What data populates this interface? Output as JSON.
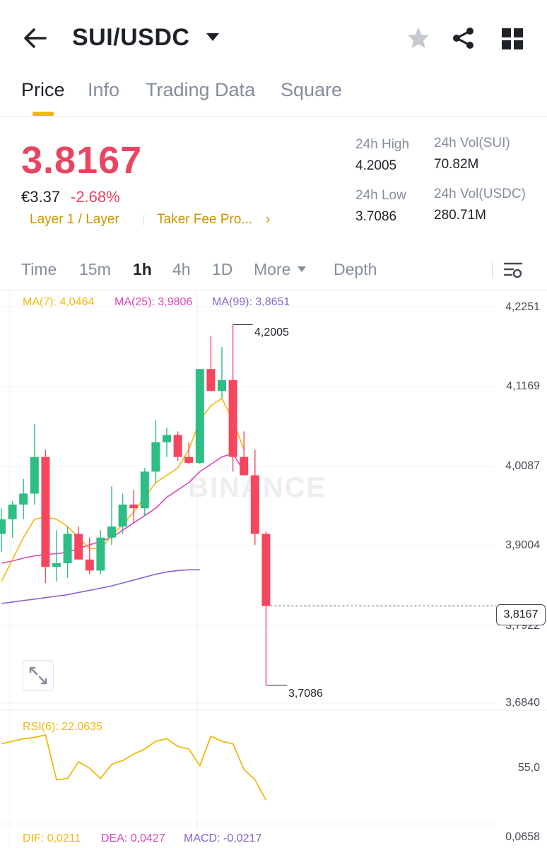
{
  "header": {
    "pair": "SUI/USDC",
    "icons": [
      "back-arrow-icon",
      "caret-down-icon",
      "star-icon",
      "share-icon",
      "grid-icon"
    ]
  },
  "tabs": [
    {
      "label": "Price",
      "active": true
    },
    {
      "label": "Info"
    },
    {
      "label": "Trading Data"
    },
    {
      "label": "Square"
    }
  ],
  "ticker": {
    "last_price": "3.8167",
    "fiat_price": "€3.37",
    "change_pct": "-2.68%",
    "tag_layer": "Layer 1 / Layer",
    "tag_fee": "Taker Fee Pro...",
    "tag_arrow": "›",
    "high_label": "24h High",
    "high_value": "4.2005",
    "low_label": "24h Low",
    "low_value": "3.7086",
    "vol_base_label": "24h Vol(SUI)",
    "vol_base_value": "70.82M",
    "vol_quote_label": "24h Vol(USDC)",
    "vol_quote_value": "280.71M"
  },
  "intervals": {
    "items": [
      "Time",
      "15m",
      "1h",
      "4h",
      "1D"
    ],
    "active": "1h",
    "more": "More",
    "depth": "Depth"
  },
  "ma_legend": {
    "ma7": "MA(7): 4,0464",
    "ma25": "MA(25): 3,9806",
    "ma99": "MA(99): 3,8651"
  },
  "colors": {
    "up": "#2ebd85",
    "down": "#f6465d",
    "ma7": "#f0b90b",
    "ma25": "#d946b8",
    "ma99": "#8a63c9",
    "accent": "#f0b90b"
  },
  "watermark": "BINANCE",
  "chart_data": {
    "type": "candlestick",
    "y_axis_labels": [
      "4,2251",
      "4,1169",
      "4,0087",
      "3,9004",
      "3,7922",
      "3,6840"
    ],
    "ylim": [
      3.684,
      4.2251
    ],
    "current_price_label": "3,8167",
    "high_marker": "4,2005",
    "low_marker": "3,7086",
    "candles": [
      {
        "o": 3.915,
        "h": 3.95,
        "l": 3.89,
        "c": 3.935
      },
      {
        "o": 3.935,
        "h": 3.96,
        "l": 3.91,
        "c": 3.955
      },
      {
        "o": 3.955,
        "h": 3.99,
        "l": 3.935,
        "c": 3.97
      },
      {
        "o": 3.97,
        "h": 4.065,
        "l": 3.955,
        "c": 4.02
      },
      {
        "o": 4.02,
        "h": 4.03,
        "l": 3.848,
        "c": 3.87
      },
      {
        "o": 3.87,
        "h": 3.92,
        "l": 3.85,
        "c": 3.875
      },
      {
        "o": 3.875,
        "h": 3.925,
        "l": 3.855,
        "c": 3.915
      },
      {
        "o": 3.915,
        "h": 3.925,
        "l": 3.88,
        "c": 3.88
      },
      {
        "o": 3.88,
        "h": 3.91,
        "l": 3.86,
        "c": 3.865
      },
      {
        "o": 3.865,
        "h": 3.92,
        "l": 3.86,
        "c": 3.91
      },
      {
        "o": 3.91,
        "h": 3.98,
        "l": 3.9,
        "c": 3.925
      },
      {
        "o": 3.925,
        "h": 3.97,
        "l": 3.915,
        "c": 3.955
      },
      {
        "o": 3.955,
        "h": 3.975,
        "l": 3.93,
        "c": 3.95
      },
      {
        "o": 3.95,
        "h": 4.005,
        "l": 3.94,
        "c": 4.0
      },
      {
        "o": 4.0,
        "h": 4.07,
        "l": 3.985,
        "c": 4.04
      },
      {
        "o": 4.04,
        "h": 4.06,
        "l": 4.02,
        "c": 4.05
      },
      {
        "o": 4.05,
        "h": 4.055,
        "l": 4.015,
        "c": 4.02
      },
      {
        "o": 4.02,
        "h": 4.04,
        "l": 4.01,
        "c": 4.012
      },
      {
        "o": 4.012,
        "h": 4.14,
        "l": 4.01,
        "c": 4.14
      },
      {
        "o": 4.14,
        "h": 4.185,
        "l": 4.11,
        "c": 4.11
      },
      {
        "o": 4.11,
        "h": 4.17,
        "l": 4.1,
        "c": 4.125
      },
      {
        "o": 4.125,
        "h": 4.2005,
        "l": 4.0,
        "c": 4.02
      },
      {
        "o": 4.02,
        "h": 4.055,
        "l": 3.998,
        "c": 3.995
      },
      {
        "o": 3.995,
        "h": 4.03,
        "l": 3.9,
        "c": 3.915
      },
      {
        "o": 3.915,
        "h": 3.918,
        "l": 3.7086,
        "c": 3.8167
      }
    ],
    "ma7": [
      3.85,
      3.88,
      3.91,
      3.935,
      3.938,
      3.935,
      3.925,
      3.91,
      3.895,
      3.895,
      3.912,
      3.928,
      3.945,
      3.965,
      3.985,
      3.995,
      4.005,
      4.03,
      4.07,
      4.09,
      4.1,
      4.07,
      4.03
    ],
    "ma25": [
      3.875,
      3.878,
      3.882,
      3.885,
      3.887,
      3.888,
      3.89,
      3.895,
      3.9,
      3.905,
      3.91,
      3.92,
      3.93,
      3.94,
      3.95,
      3.965,
      3.975,
      3.985,
      4.0,
      4.01,
      4.02,
      4.025,
      4.0
    ],
    "ma99": [
      3.82,
      3.822,
      3.824,
      3.826,
      3.828,
      3.83,
      3.832,
      3.835,
      3.838,
      3.841,
      3.844,
      3.848,
      3.852,
      3.856,
      3.86,
      3.863,
      3.865,
      3.866,
      3.866
    ],
    "rsi": {
      "label": "RSI(6): 22,0635",
      "axis_label": "55,0",
      "values": [
        62,
        64,
        66,
        67,
        69,
        34,
        35,
        48,
        43,
        35,
        46,
        49,
        54,
        58,
        64,
        66,
        60,
        58,
        45,
        68,
        64,
        62,
        42,
        34,
        18
      ]
    },
    "macd": {
      "dif_label": "DIF: 0,0211",
      "dea_label": "DEA: 0,0427",
      "macd_label": "MACD: -0,0217",
      "axis_label": "0,0658"
    }
  }
}
